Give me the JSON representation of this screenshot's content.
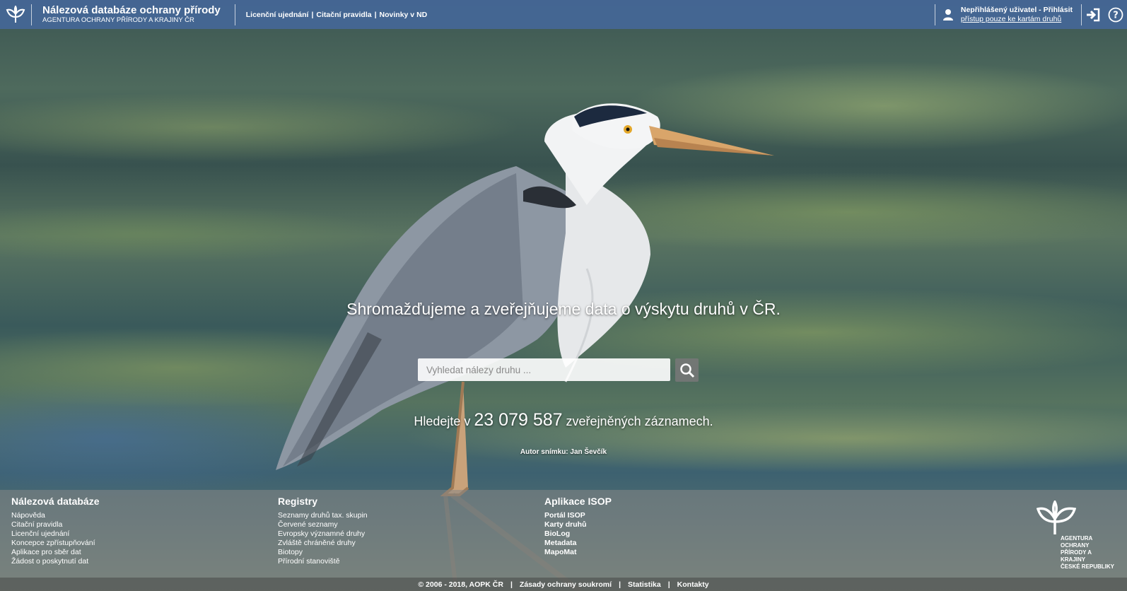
{
  "header": {
    "title": "Nálezová databáze ochrany přírody",
    "subtitle": "AGENTURA OCHRANY PŘÍRODY A KRAJINY ČR",
    "links": [
      "Licenční ujednání",
      "Citační pravidla",
      "Novinky v ND"
    ],
    "link_separator": "|",
    "user_status": "Nepřihlášený uživatel - Přihlásit",
    "user_note": "přístup pouze ke kartám druhů"
  },
  "hero": {
    "tagline": "Shromažďujeme a zveřejňujeme data o výskytu druhů v ČR.",
    "search_placeholder": "Vyhledat nálezy druhu ...",
    "count_prefix": "Hledejte v",
    "count_value": "23 079 587",
    "count_suffix": "zveřejněných záznamech.",
    "photo_credit": "Autor snímku: Jan Ševčík"
  },
  "footer": {
    "col1": {
      "title": "Nálezová databáze",
      "items": [
        "Nápověda",
        "Citační pravidla",
        "Licenční ujednání",
        "Koncepce zpřístupňování",
        "Aplikace pro sběr dat",
        "Žádost o poskytnutí dat"
      ]
    },
    "col2": {
      "title": "Registry",
      "items": [
        "Seznamy druhů tax. skupin",
        "Červené seznamy",
        "Evropsky významné druhy",
        "Zvláště chráněné druhy",
        "Biotopy",
        "Přírodní stanoviště"
      ]
    },
    "col3": {
      "title": "Aplikace ISOP",
      "items": [
        "Portál ISOP",
        "Karty druhů",
        "BioLog",
        "Metadata",
        "MapoMat"
      ]
    },
    "logo_text": [
      "AGENTURA OCHRANY",
      "PŘÍRODY A KRAJINY",
      "ČESKÉ REPUBLIKY"
    ]
  },
  "bottom": {
    "copyright": "© 2006 - 2018, AOPK ČR",
    "links": [
      "Zásady ochrany soukromí",
      "Statistika",
      "Kontakty"
    ],
    "separator": "|"
  },
  "colors": {
    "header_bg": "#4669a0",
    "footer_bg": "#878787"
  }
}
